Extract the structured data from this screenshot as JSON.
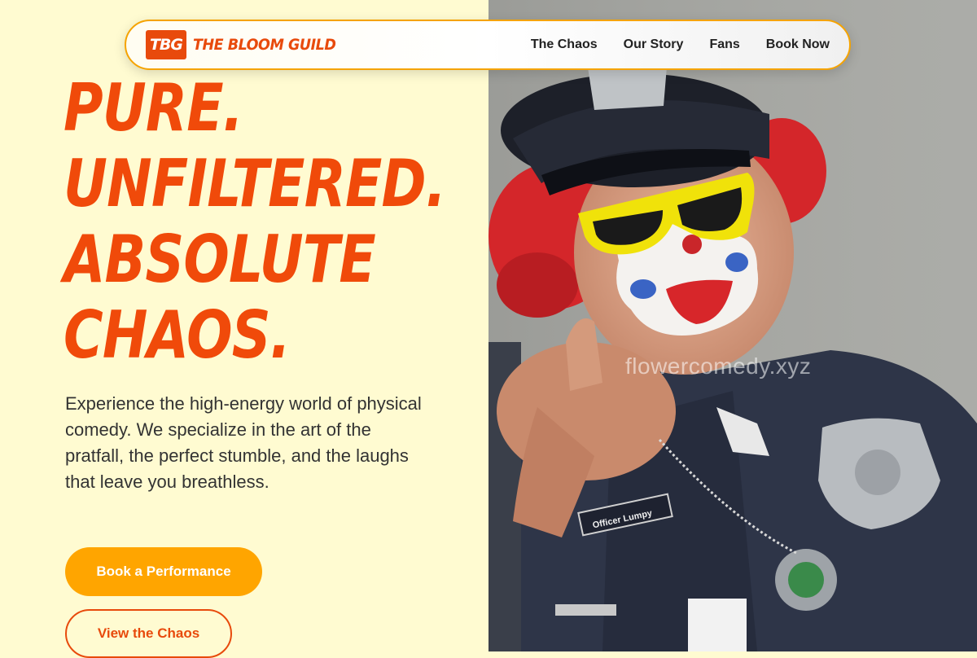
{
  "nav": {
    "logo_badge": "TBG",
    "logo_text": "THE BLOOM GUILD",
    "links": [
      "The Chaos",
      "Our Story",
      "Fans",
      "Book Now"
    ]
  },
  "hero": {
    "headline": [
      "PURE.",
      "UNFILTERED.",
      "ABSOLUTE",
      "CHAOS."
    ],
    "description": "Experience the high-energy world of physical comedy. We specialize in the art of the pratfall, the perfect stumble, and the laughs that leave you breathless.",
    "primary_button": "Book a Performance",
    "secondary_button": "View the Chaos"
  },
  "photo": {
    "name_tag": "Officer Lumpy",
    "watermark": "flowercomedy.xyz"
  },
  "colors": {
    "accent_orange": "#f04a0a",
    "button_yellow": "#ffa500",
    "background": "#fffbd1"
  }
}
